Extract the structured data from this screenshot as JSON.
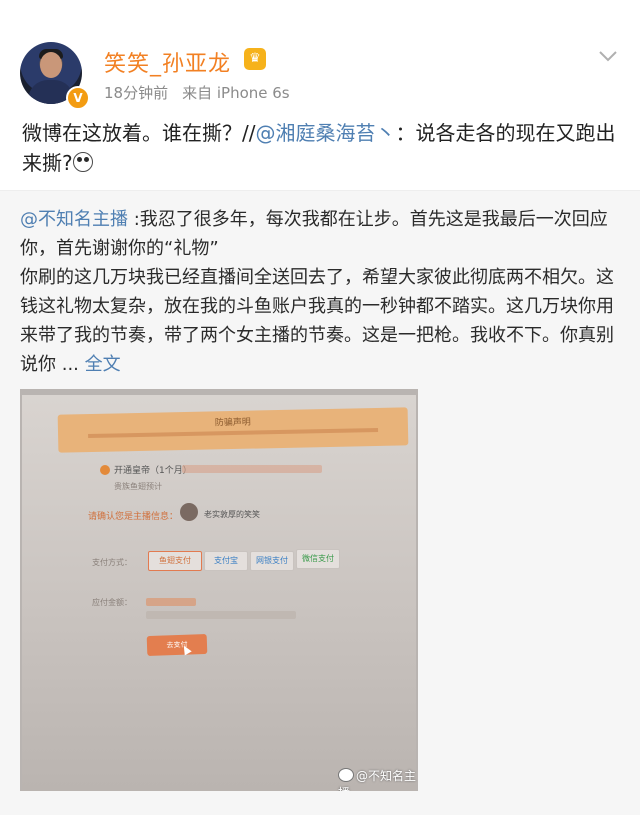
{
  "header": {
    "username": "笑笑_孙亚龙",
    "verified_badge": "V",
    "vip_badge_icon": "crown-icon",
    "time": "18分钟前",
    "source": "来自 iPhone 6s"
  },
  "post": {
    "text_prefix": "微博在这放着。谁在撕？//",
    "mention": "@湘庭桑海苔丶",
    "text_suffix": "：说各走各的现在又跑出来撕?",
    "emoji": "scared-face-emoji"
  },
  "repost": {
    "mention": "@不知名主播",
    "text": " :我忍了很多年，每次我都在让步。首先这是我最后一次回应你，首先谢谢你的“礼物”\n你刷的这几万块我已经直播间全送回去了，希望大家彼此彻底两不相欠。这钱这礼物太复杂，放在我的斗鱼账户我真的一秒钟都不踏实。这几万块你用来带了我的节奏，带了两个女主播的节奏。这是一把枪。我收不下。你真别说你 ... ",
    "more_link": "全文",
    "image": {
      "banner_title": "防骗声明",
      "line_1": "开通皇帝（1个月）",
      "line_2": "贵族鱼翅预计",
      "streamer_label": "请确认您是主播信息：",
      "streamer_name": "老实敦厚的笑笑",
      "pay_label": "支付方式：",
      "pay_options": [
        "鱼翅支付",
        "支付宝",
        "网银支付",
        "微信支付"
      ],
      "amount_label": "应付金额：",
      "pay_button": "去支付",
      "watermark": "@不知名主播"
    }
  },
  "colors": {
    "username": "#f28023",
    "link": "#4f7fb2",
    "repost_bg": "#f6f6f6"
  }
}
